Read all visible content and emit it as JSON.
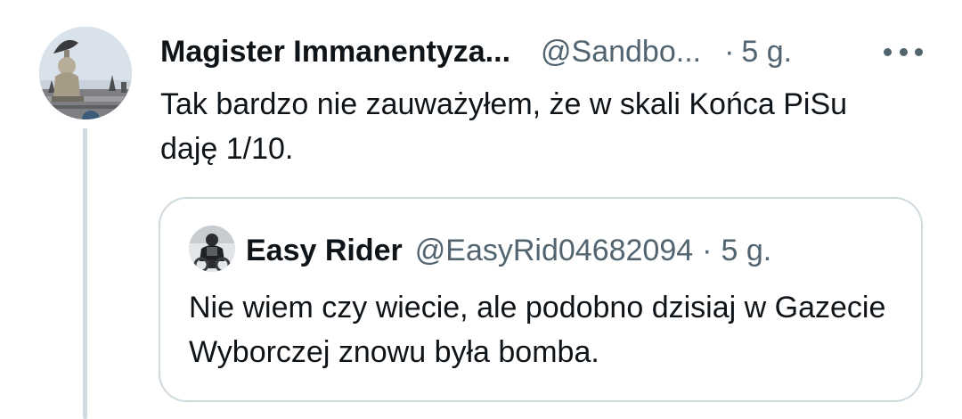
{
  "tweet": {
    "author_name": "Magister Immanentyza...",
    "author_handle": "@Sandbo...",
    "separator": "·",
    "time": "5 g.",
    "text": "Tak bardzo nie zauważyłem, że w skali Końca PiSu daję 1/10."
  },
  "quoted_tweet": {
    "author_name": "Easy Rider",
    "author_handle": "@EasyRid04682094",
    "separator": "·",
    "time": "5 g.",
    "text": "Nie wiem czy wiecie, ale podobno dzisiaj w Gazecie Wyborczej znowu była bomba."
  },
  "icons": {
    "more": "more-horizontal-icon"
  },
  "colors": {
    "text_primary": "#0f1419",
    "text_secondary": "#536471",
    "border": "#cfd9de",
    "background": "#ffffff"
  }
}
